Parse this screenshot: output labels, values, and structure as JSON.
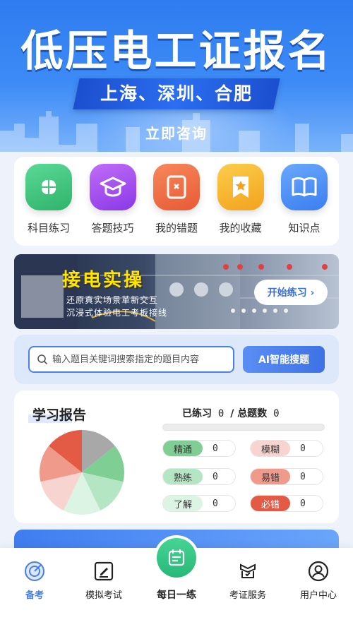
{
  "hero": {
    "title": "低压电工证报名",
    "cities": "上海、深圳、合肥",
    "consult": "立即咨询"
  },
  "shortcuts": [
    {
      "label": "科目练习",
      "icon": "clover-icon",
      "color": "#38c27a"
    },
    {
      "label": "答题技巧",
      "icon": "graduation-cap-icon",
      "color": "#a04bf0"
    },
    {
      "label": "我的错题",
      "icon": "wrong-book-icon",
      "color": "#f06a3c"
    },
    {
      "label": "我的收藏",
      "icon": "star-bookmark-icon",
      "color": "#f7b72a"
    },
    {
      "label": "知识点",
      "icon": "open-book-icon",
      "color": "#4a8ff5"
    }
  ],
  "practice": {
    "title": "接电实操",
    "line1": "还原真实场景革新交互",
    "line2": "沉浸式体验电工考板接线",
    "button": "开始练习 ›"
  },
  "search": {
    "placeholder": "输入题目关键词搜索指定的题目内容",
    "ai_button": "AI智能搜题"
  },
  "report": {
    "title": "学习报告",
    "practiced_label": "已练习",
    "practiced": "0",
    "separator": "/",
    "total_label": "总题数",
    "total": "0",
    "progress": 0,
    "stats": [
      {
        "label": "精通",
        "value": "0",
        "color": "#7fcf95"
      },
      {
        "label": "模糊",
        "value": "0",
        "color": "#f7d4d0"
      },
      {
        "label": "熟练",
        "value": "0",
        "color": "#b5e6c4"
      },
      {
        "label": "易错",
        "value": "0",
        "color": "#ef9a8b"
      },
      {
        "label": "了解",
        "value": "0",
        "color": "#dcf4e4"
      },
      {
        "label": "必错",
        "value": "0",
        "color": "#e35b45"
      }
    ]
  },
  "nav": {
    "items": [
      {
        "label": "备考",
        "icon": "target-icon"
      },
      {
        "label": "模拟考试",
        "icon": "exam-edit-icon"
      },
      {
        "label": "每日一练",
        "icon": "daily-calendar-icon"
      },
      {
        "label": "考证服务",
        "icon": "service-bowtie-icon"
      },
      {
        "label": "用户中心",
        "icon": "user-icon"
      }
    ]
  }
}
